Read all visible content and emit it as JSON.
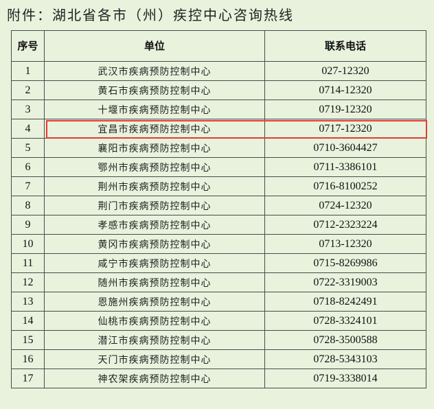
{
  "title": "附件：湖北省各市（州）疾控中心咨询热线",
  "table": {
    "headers": {
      "no": "序号",
      "unit": "单位",
      "phone": "联系电话"
    },
    "rows": [
      {
        "no": "1",
        "unit": "武汉市疾病预防控制中心",
        "phone": "027-12320"
      },
      {
        "no": "2",
        "unit": "黄石市疾病预防控制中心",
        "phone": "0714-12320"
      },
      {
        "no": "3",
        "unit": "十堰市疾病预防控制中心",
        "phone": "0719-12320"
      },
      {
        "no": "4",
        "unit": "宜昌市疾病预防控制中心",
        "phone": "0717-12320"
      },
      {
        "no": "5",
        "unit": "襄阳市疾病预防控制中心",
        "phone": "0710-3604427"
      },
      {
        "no": "6",
        "unit": "鄂州市疾病预防控制中心",
        "phone": "0711-3386101"
      },
      {
        "no": "7",
        "unit": "荆州市疾病预防控制中心",
        "phone": "0716-8100252"
      },
      {
        "no": "8",
        "unit": "荆门市疾病预防控制中心",
        "phone": "0724-12320"
      },
      {
        "no": "9",
        "unit": "孝感市疾病预防控制中心",
        "phone": "0712-2323224"
      },
      {
        "no": "10",
        "unit": "黄冈市疾病预防控制中心",
        "phone": "0713-12320"
      },
      {
        "no": "11",
        "unit": "咸宁市疾病预防控制中心",
        "phone": "0715-8269986"
      },
      {
        "no": "12",
        "unit": "随州市疾病预防控制中心",
        "phone": "0722-3319003"
      },
      {
        "no": "13",
        "unit": "恩施州疾病预防控制中心",
        "phone": "0718-8242491"
      },
      {
        "no": "14",
        "unit": "仙桃市疾病预防控制中心",
        "phone": "0728-3324101"
      },
      {
        "no": "15",
        "unit": "潜江市疾病预防控制中心",
        "phone": "0728-3500588"
      },
      {
        "no": "16",
        "unit": "天门市疾病预防控制中心",
        "phone": "0728-5343103"
      },
      {
        "no": "17",
        "unit": "神农架疾病预防控制中心",
        "phone": "0719-3338014"
      }
    ],
    "highlighted_row_index": 3,
    "highlight_color": "#e53935"
  },
  "colors": {
    "background": "#e8f2dd",
    "border": "#4a4a4a"
  }
}
